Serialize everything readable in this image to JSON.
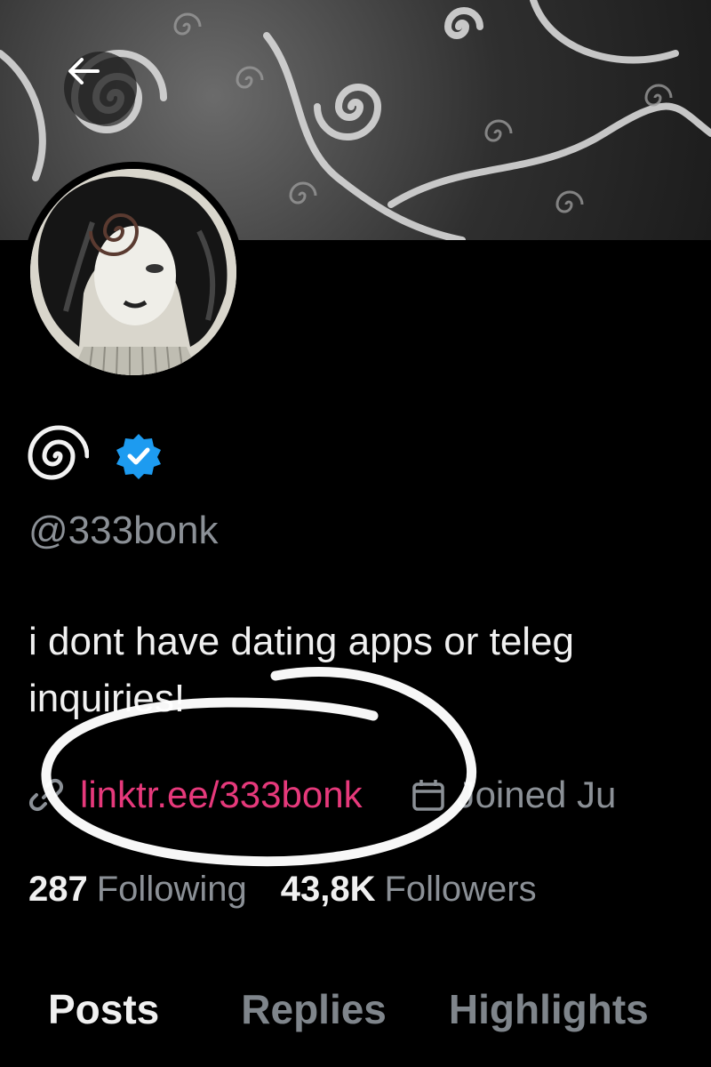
{
  "profile": {
    "display_name_icon": "spiral-icon",
    "verified_icon": "verified-badge-icon",
    "handle": "@333bonk",
    "bio_line1": "i dont have dating apps or teleg",
    "bio_line2": "inquiries!",
    "link": "linktr.ee/333bonk",
    "joined": "Joined Ju",
    "following_count": "287",
    "following_label": "Following",
    "followers_count": "43,8K",
    "followers_label": "Followers"
  },
  "tabs": [
    {
      "label": "Posts",
      "active": true
    },
    {
      "label": "Replies",
      "active": false
    },
    {
      "label": "Highlights",
      "active": false
    }
  ],
  "colors": {
    "background": "#000000",
    "link": "#e6397b",
    "muted": "#8b9096",
    "verified": "#1d9bf0"
  }
}
